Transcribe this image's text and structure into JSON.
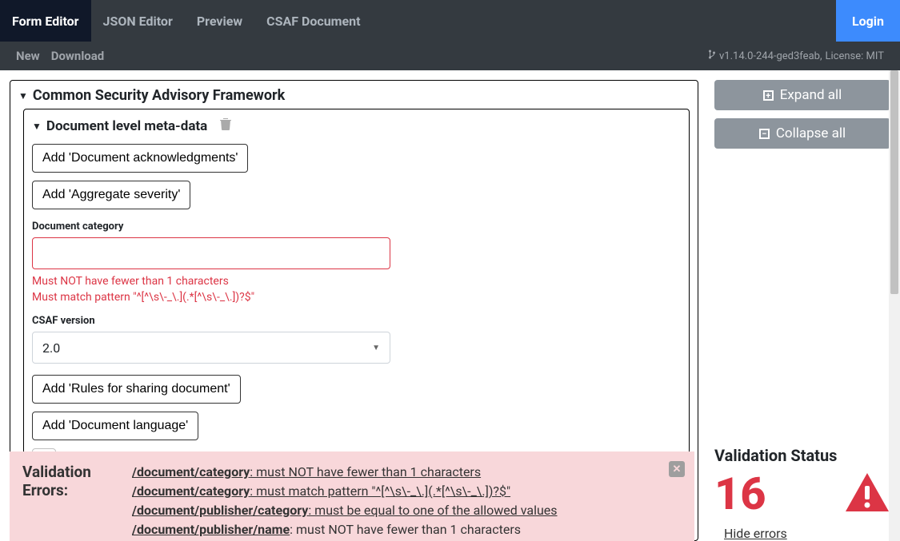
{
  "nav": {
    "tabs": [
      "Form Editor",
      "JSON Editor",
      "Preview",
      "CSAF Document"
    ],
    "login": "Login"
  },
  "subnav": {
    "new": "New",
    "download": "Download",
    "version": "v1.14.0-244-ged3feab,",
    "license": "License: MIT"
  },
  "editor": {
    "root_title": "Common Security Advisory Framework",
    "meta_title": "Document level meta-data",
    "add_ack": "Add 'Document acknowledgments'",
    "add_severity": "Add 'Aggregate severity'",
    "cat_label": "Document category",
    "cat_value": "",
    "cat_err1": "Must NOT have fewer than 1 characters",
    "cat_err2": "Must match pattern \"^[^\\s\\-_\\.](.*[^\\s\\-_\\.])?$\"",
    "csaf_label": "CSAF version",
    "csaf_value": "2.0",
    "add_rules": "Add 'Rules for sharing document'",
    "add_lang": "Add 'Document language'"
  },
  "side": {
    "expand": "Expand all",
    "collapse": "Collapse all",
    "status_title": "Validation Status",
    "count": "16",
    "hide": "Hide errors"
  },
  "errpanel": {
    "title": "Validation Errors:",
    "rows": [
      {
        "path": "/document/category",
        "msg": ": must NOT have fewer than 1 characters"
      },
      {
        "path": "/document/category",
        "msg": ": must match pattern \"^[^\\s\\-_\\.](.*[^\\s\\-_\\.])?$\""
      },
      {
        "path": "/document/publisher/category",
        "msg": ": must be equal to one of the allowed values"
      },
      {
        "path": "/document/publisher/name",
        "msg": ": must NOT have fewer than 1 characters"
      }
    ]
  }
}
